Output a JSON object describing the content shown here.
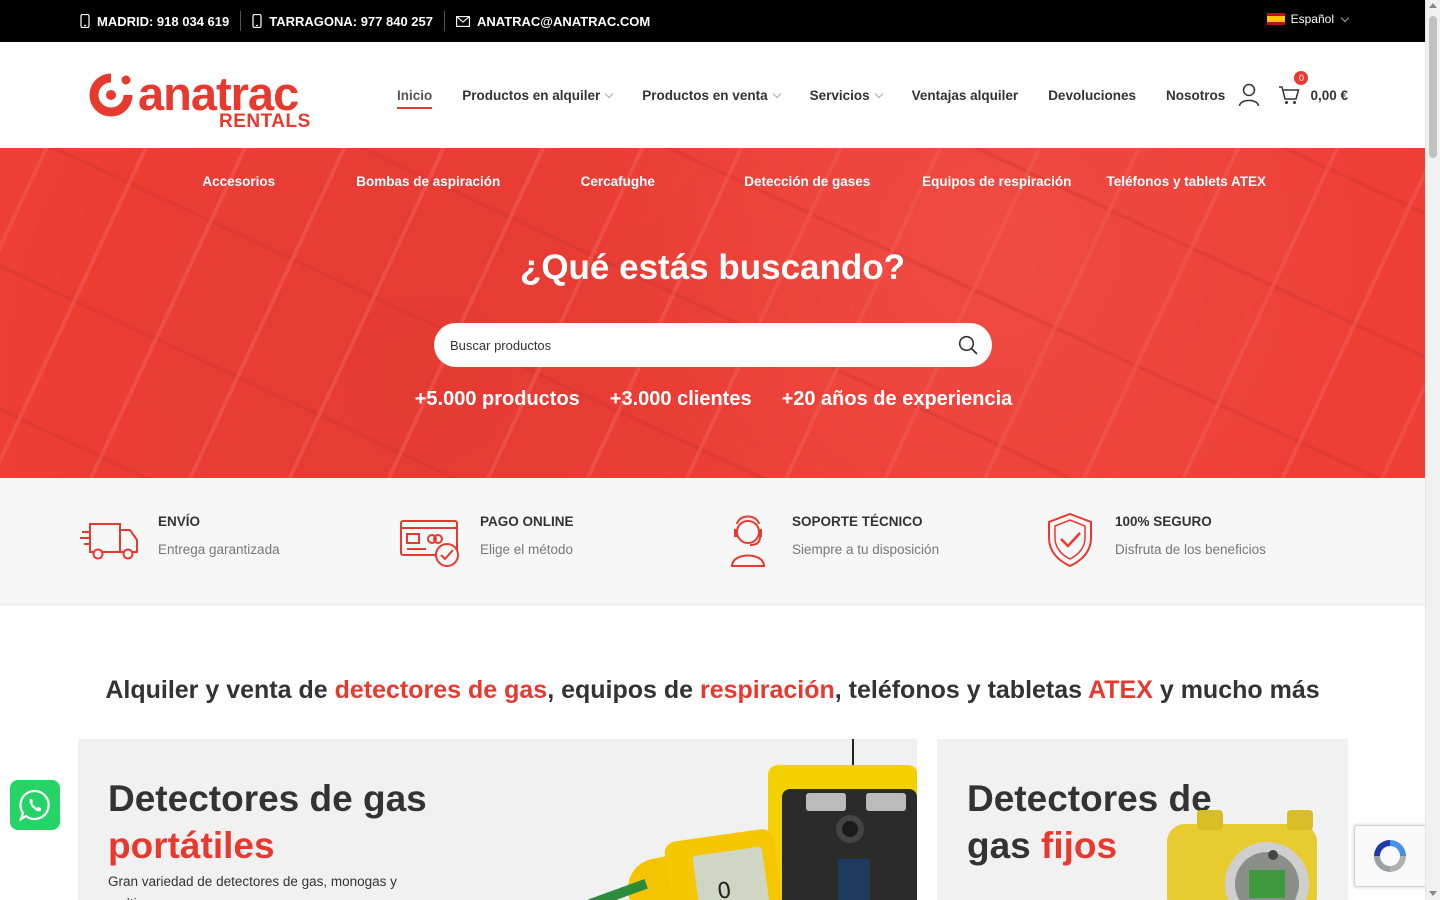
{
  "topbar": {
    "phone_madrid": "MADRID: 918 034 619",
    "phone_tarragona": "TARRAGONA: 977 840 257",
    "email": "ANATRAC@ANATRAC.COM",
    "language": "Español"
  },
  "logo": {
    "name": "anatrac",
    "tagline": "RENTALS"
  },
  "nav": [
    {
      "label": "Inicio"
    },
    {
      "label": "Productos en alquiler"
    },
    {
      "label": "Productos en venta"
    },
    {
      "label": "Servicios"
    },
    {
      "label": "Ventajas alquiler"
    },
    {
      "label": "Devoluciones"
    },
    {
      "label": "Nosotros"
    }
  ],
  "cart": {
    "count": "0",
    "total": "0,00 €"
  },
  "hero": {
    "categories": [
      "Accesorios",
      "Bombas de aspiración",
      "Cercafughe",
      "Detección de gases",
      "Equipos de respiración",
      "Teléfonos y tablets ATEX"
    ],
    "heading": "¿Qué estás buscando?",
    "search_placeholder": "Buscar productos",
    "stats": [
      "+5.000 productos",
      "+3.000 clientes",
      "+20 años de experiencia"
    ]
  },
  "features": [
    {
      "title": "ENVÍO",
      "subtitle": "Entrega garantizada",
      "icon": "truck-icon"
    },
    {
      "title": "PAGO ONLINE",
      "subtitle": "Elige el método",
      "icon": "payment-card-icon"
    },
    {
      "title": "SOPORTE TÉCNICO",
      "subtitle": "Siempre a tu disposición",
      "icon": "support-agent-icon"
    },
    {
      "title": "100% SEGURO",
      "subtitle": "Disfruta de los beneficios",
      "icon": "shield-check-icon"
    }
  ],
  "section": {
    "t1": "Alquiler y venta de ",
    "t2": "detectores de gas",
    "t3": ", equipos de ",
    "t4": "respiración",
    "t5": ", teléfonos y tabletas ",
    "t6": "ATEX",
    "t7": " y mucho más"
  },
  "cards": [
    {
      "title_dark": "Detectores de gas",
      "title_red": "portátiles",
      "text": "Gran variedad de detectores de gas, monogas y multigas"
    },
    {
      "title_dark": "Detectores de",
      "title_dark2": "gas ",
      "title_red": "fijos"
    }
  ],
  "colors": {
    "accent": "#e8392f",
    "hero_bg": "#ee3e36",
    "whatsapp": "#25d366"
  }
}
